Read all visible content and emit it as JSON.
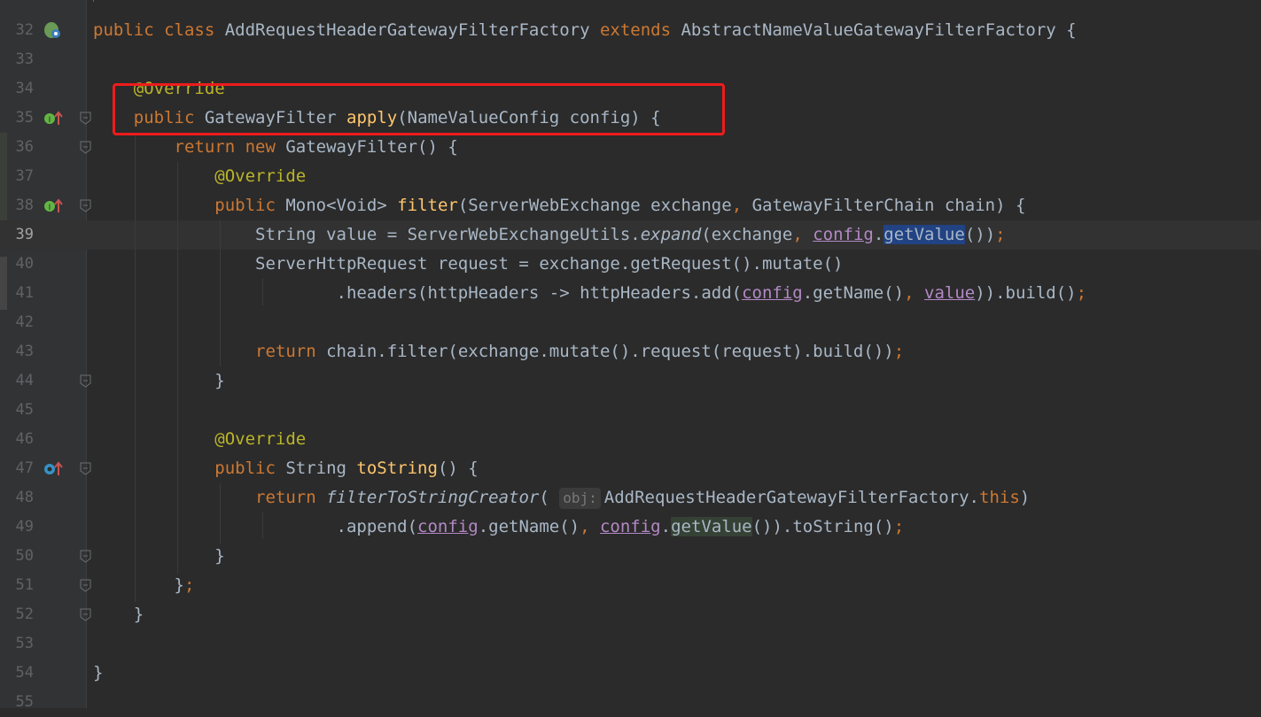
{
  "editor": {
    "lines": [
      {
        "num": "32",
        "code": [
          {
            "t": "public class ",
            "c": "kw"
          },
          {
            "t": "AddRequestHeaderGatewayFilterFactory "
          },
          {
            "t": "extends ",
            "c": "kw"
          },
          {
            "t": "AbstractNameValueGatewayFilterFactory {"
          }
        ]
      },
      {
        "num": "33",
        "code": []
      },
      {
        "num": "34",
        "code": [
          {
            "t": "    @Override",
            "c": "ann"
          }
        ]
      },
      {
        "num": "35",
        "code": [
          {
            "t": "    public ",
            "c": "kw"
          },
          {
            "t": "GatewayFilter "
          },
          {
            "t": "apply",
            "c": "fn"
          },
          {
            "t": "(NameValueConfig config) {"
          }
        ]
      },
      {
        "num": "36",
        "code": [
          {
            "t": "        return new ",
            "c": "kw"
          },
          {
            "t": "GatewayFilter() {"
          }
        ]
      },
      {
        "num": "37",
        "code": [
          {
            "t": "            @Override",
            "c": "ann"
          }
        ]
      },
      {
        "num": "38",
        "code": [
          {
            "t": "            public ",
            "c": "kw"
          },
          {
            "t": "Mono<Void> "
          },
          {
            "t": "filter",
            "c": "fn"
          },
          {
            "t": "(ServerWebExchange exchange"
          },
          {
            "t": ", ",
            "c": "kw"
          },
          {
            "t": "GatewayFilterChain chain) {"
          }
        ]
      },
      {
        "num": "39",
        "code": [
          {
            "t": "                String value = ServerWebExchangeUtils."
          },
          {
            "t": "expand",
            "c": "it"
          },
          {
            "t": "(exchange"
          },
          {
            "t": ", ",
            "c": "kw"
          },
          {
            "t": "config",
            "c": "fld"
          },
          {
            "t": "."
          },
          {
            "t": "getValue",
            "c": "hl-blue"
          },
          {
            "t": "())"
          },
          {
            "t": ";",
            "c": "kw"
          }
        ]
      },
      {
        "num": "40",
        "code": [
          {
            "t": "                ServerHttpRequest request = exchange.getRequest().mutate()"
          }
        ]
      },
      {
        "num": "41",
        "code": [
          {
            "t": "                        .headers(httpHeaders -> httpHeaders.add("
          },
          {
            "t": "config",
            "c": "fld"
          },
          {
            "t": ".getName()"
          },
          {
            "t": ", ",
            "c": "kw"
          },
          {
            "t": "value",
            "c": "fld"
          },
          {
            "t": ")).build()"
          },
          {
            "t": ";",
            "c": "kw"
          }
        ]
      },
      {
        "num": "42",
        "code": []
      },
      {
        "num": "43",
        "code": [
          {
            "t": "                return ",
            "c": "kw"
          },
          {
            "t": "chain.filter(exchange.mutate().request(request).build())"
          },
          {
            "t": ";",
            "c": "kw"
          }
        ]
      },
      {
        "num": "44",
        "code": [
          {
            "t": "            }"
          }
        ]
      },
      {
        "num": "45",
        "code": []
      },
      {
        "num": "46",
        "code": [
          {
            "t": "            @Override",
            "c": "ann"
          }
        ]
      },
      {
        "num": "47",
        "code": [
          {
            "t": "            public ",
            "c": "kw"
          },
          {
            "t": "String "
          },
          {
            "t": "toString",
            "c": "fn"
          },
          {
            "t": "() {"
          }
        ]
      },
      {
        "num": "48",
        "code": [
          {
            "t": "                return ",
            "c": "kw"
          },
          {
            "t": "filterToStringCreator",
            "c": "it"
          },
          {
            "t": "( "
          },
          {
            "t": "obj:",
            "c": "hint"
          },
          {
            "t": "AddRequestHeaderGatewayFilterFactory."
          },
          {
            "t": "this",
            "c": "kw"
          },
          {
            "t": ")"
          }
        ]
      },
      {
        "num": "49",
        "code": [
          {
            "t": "                        .append("
          },
          {
            "t": "config",
            "c": "fld"
          },
          {
            "t": ".getName()"
          },
          {
            "t": ", ",
            "c": "kw"
          },
          {
            "t": "config",
            "c": "fld"
          },
          {
            "t": "."
          },
          {
            "t": "getValue",
            "c": "hl-green"
          },
          {
            "t": "()).toString()"
          },
          {
            "t": ";",
            "c": "kw"
          }
        ]
      },
      {
        "num": "50",
        "code": [
          {
            "t": "            }"
          }
        ]
      },
      {
        "num": "51",
        "code": [
          {
            "t": "        }"
          },
          {
            "t": ";",
            "c": "kw"
          }
        ]
      },
      {
        "num": "52",
        "code": [
          {
            "t": "    }"
          }
        ]
      },
      {
        "num": "53",
        "code": []
      },
      {
        "num": "54",
        "code": [
          {
            "t": "}"
          }
        ]
      },
      {
        "num": "55",
        "code": []
      }
    ],
    "current_line": "39",
    "gutter_icons": [
      {
        "line": "32",
        "icon": "spring-bean-icon"
      },
      {
        "line": "35",
        "icon": "implements-override-icon"
      },
      {
        "line": "38",
        "icon": "implements-override-icon"
      },
      {
        "line": "47",
        "icon": "overrides-method-icon"
      }
    ],
    "fold_markers": [
      "35",
      "36",
      "38",
      "44",
      "47",
      "50",
      "51",
      "52"
    ]
  },
  "colors": {
    "background": "#2b2b2b",
    "keyword": "#cc7832",
    "annotation": "#bbb529",
    "method_decl": "#ffc66d",
    "field": "#b389c5",
    "text": "#a9b7c6",
    "highlight_box": "#ee1c1c"
  }
}
